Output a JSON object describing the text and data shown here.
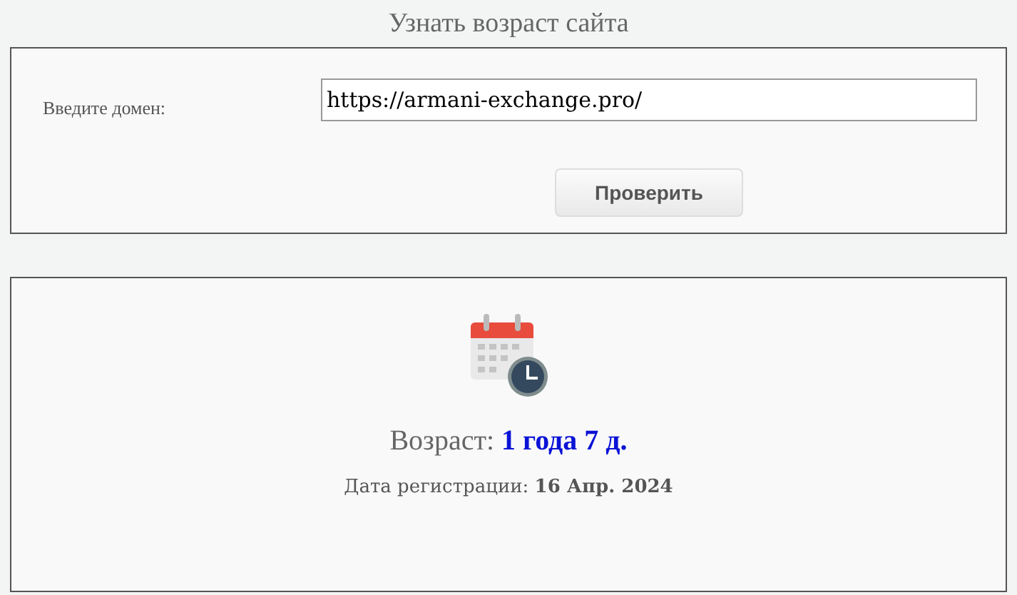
{
  "title": "Узнать возраст сайта",
  "form": {
    "label": "Введите домен:",
    "value": "https://armani-exchange.pro/",
    "button": "Проверить"
  },
  "result": {
    "age_label": "Возраст:",
    "age_value": "1 года 7 д.",
    "reg_label": "Дата регистрации:",
    "reg_value": "16 Апр. 2024"
  }
}
